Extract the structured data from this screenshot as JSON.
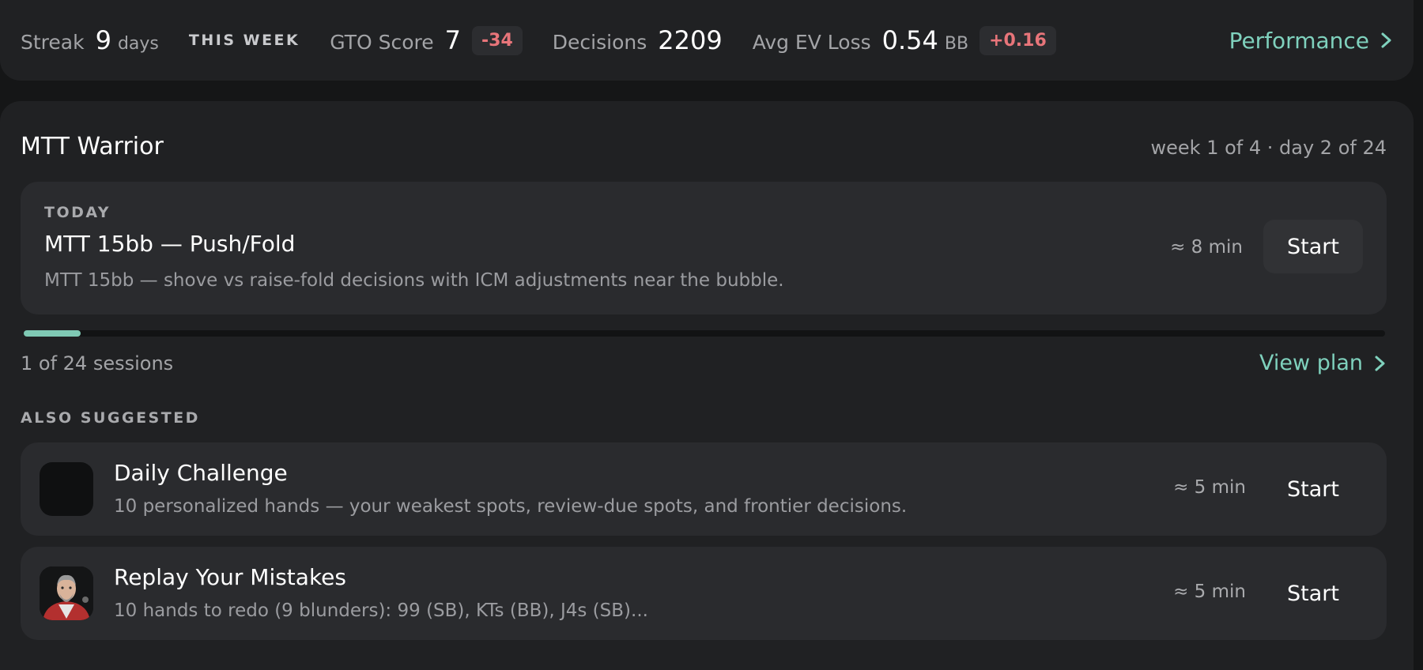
{
  "stats": {
    "streak_label": "Streak",
    "streak_value": "9",
    "streak_unit": "days",
    "week_label": "THIS WEEK",
    "gto_label": "GTO Score",
    "gto_value": "7",
    "gto_delta": "-34",
    "decisions_label": "Decisions",
    "decisions_value": "2209",
    "ev_label": "Avg EV Loss",
    "ev_value": "0.54",
    "ev_unit": "BB",
    "ev_delta": "+0.16",
    "performance_link": "Performance"
  },
  "plan": {
    "title": "MTT Warrior",
    "progress_text": "week 1 of 4 · day 2 of 24",
    "today": {
      "label": "TODAY",
      "title": "MTT 15bb — Push/Fold",
      "description": "MTT 15bb — shove vs raise-fold decisions with ICM adjustments near the bubble.",
      "duration": "≈ 8 min",
      "start_label": "Start"
    },
    "sessions_progress": 0.0417,
    "sessions_text": "1 of 24 sessions",
    "view_plan_label": "View plan"
  },
  "also_suggested": {
    "label": "ALSO SUGGESTED",
    "items": [
      {
        "title": "Daily Challenge",
        "description": "10 personalized hands — your weakest spots, review-due spots, and frontier decisions.",
        "duration": "≈ 5 min",
        "start_label": "Start",
        "icon": "challenge-icon"
      },
      {
        "title": "Replay Your Mistakes",
        "description": "10 hands to redo (9 blunders): 99 (SB), KTs (BB), J4s (SB)...",
        "duration": "≈ 5 min",
        "start_label": "Start",
        "icon": "coach-avatar"
      }
    ]
  },
  "colors": {
    "accent": "#7fd1bd",
    "negative": "#e8757a",
    "progress": "#7fc9b4"
  }
}
